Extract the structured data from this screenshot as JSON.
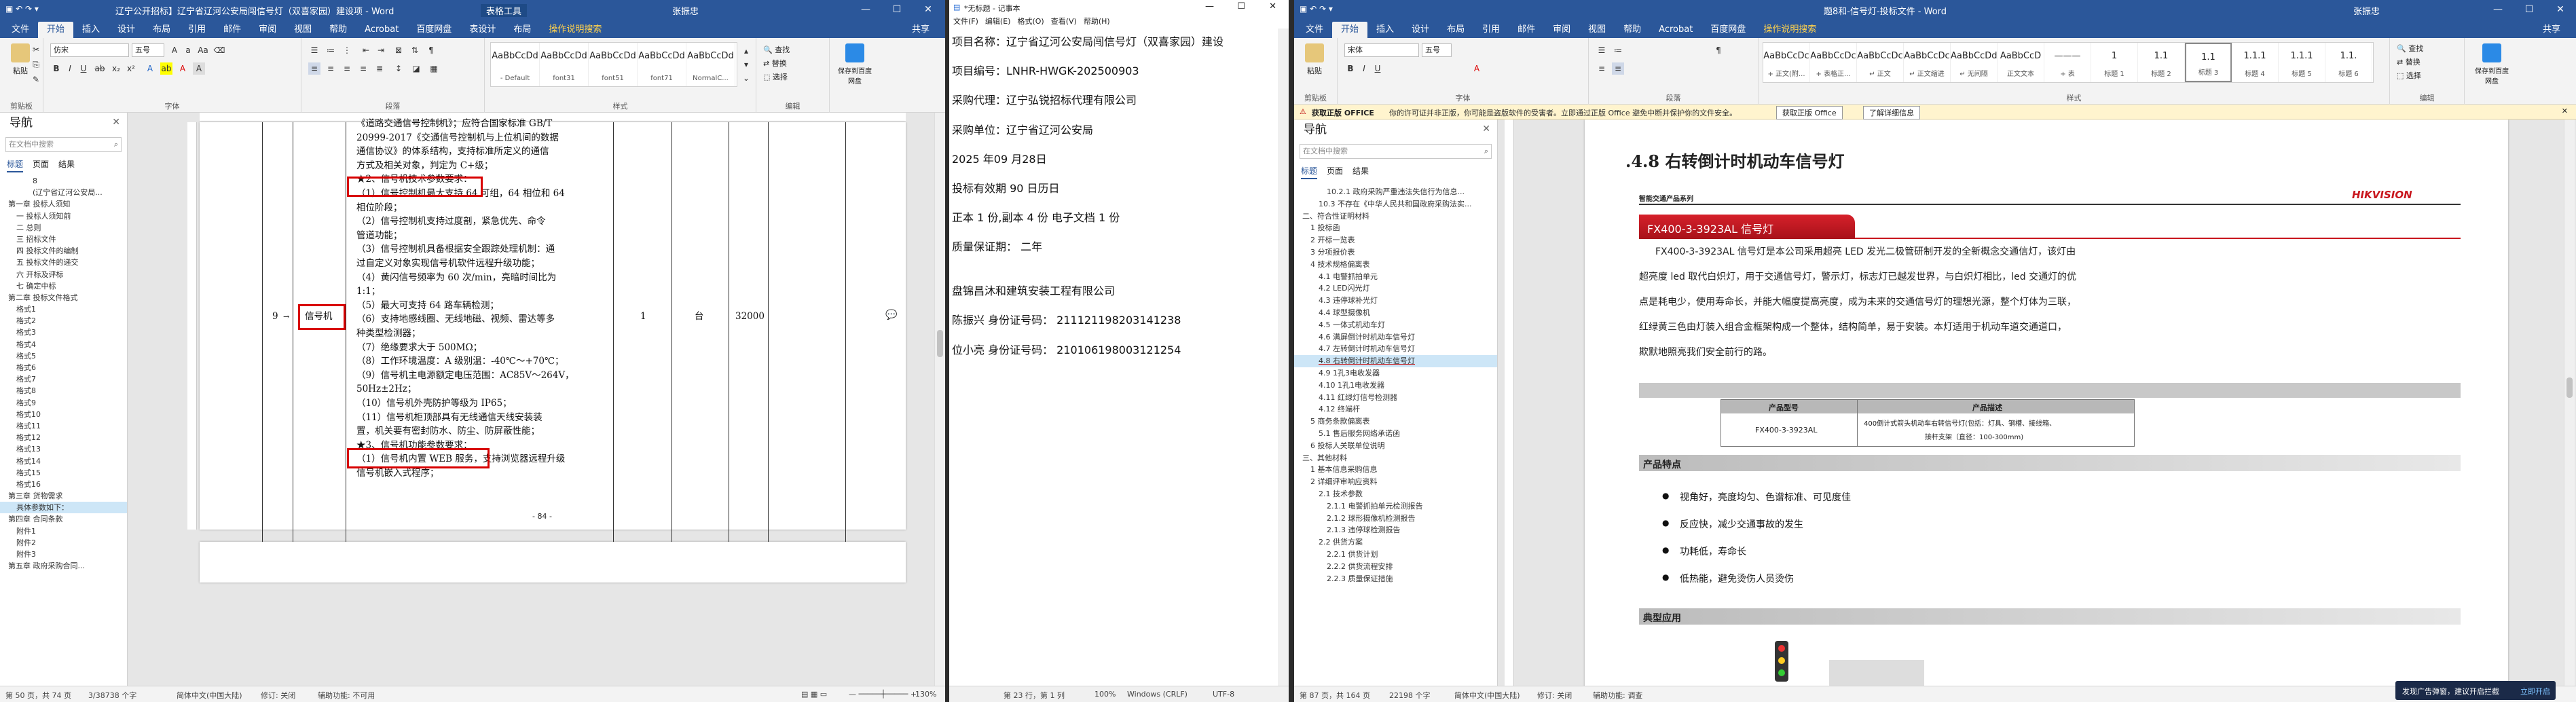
{
  "window1": {
    "title": "辽宁公开招标】辽宁省辽河公安局闯信号灯（双喜家园）建设项 - Word",
    "context_tab": "表格工具",
    "user": "张振忠",
    "share": "共享",
    "tabs": [
      "文件",
      "开始",
      "插入",
      "设计",
      "布局",
      "引用",
      "邮件",
      "审阅",
      "视图",
      "帮助",
      "Acrobat",
      "百度网盘",
      "表设计",
      "布局",
      "操作说明搜索"
    ],
    "font_name": "仿宋",
    "font_size": "五号",
    "clipboard_label": "剪贴板",
    "paste_label": "粘贴",
    "font_label": "字体",
    "para_label": "段落",
    "styles_label": "样式",
    "edit_label": "编辑",
    "save_label": "保存到百度网盘",
    "styles": [
      {
        "preview": "AaBbCcDd",
        "name": "- Default"
      },
      {
        "preview": "AaBbCcDd",
        "name": "font31"
      },
      {
        "preview": "AaBbCcDd",
        "name": "font51"
      },
      {
        "preview": "AaBbCcDd",
        "name": "font71"
      },
      {
        "preview": "AaBbCcDd",
        "name": "NormalC..."
      }
    ],
    "edit": [
      "查找",
      "替换",
      "选择"
    ],
    "nav": {
      "title": "导航",
      "search": "在文档中搜索",
      "tabs": [
        "标题",
        "页面",
        "结果"
      ],
      "items": [
        "8",
        "(辽宁省辽河公安局...",
        "第一章 投标人须知",
        "一 投标人须知前",
        "二 总则",
        "三 招标文件",
        "四 投标文件的编制",
        "五 投标文件的递交",
        "六 开标及评标",
        "七 确定中标",
        "第二章 投标文件格式",
        "格式1",
        "格式2",
        "格式3",
        "格式4",
        "格式5",
        "格式6",
        "格式7",
        "格式8",
        "格式9",
        "格式10",
        "格式11",
        "格式12",
        "格式13",
        "格式14",
        "格式15",
        "格式16",
        "第三章 货物需求",
        "具体参数如下：",
        "第四章 合同条款",
        "附件1",
        "附件2",
        "附件3",
        "第五章 政府采购合同..."
      ]
    },
    "doc": {
      "row_no": "9",
      "item": "信号机",
      "qty": "1",
      "unit": "台",
      "price": "32000",
      "lines": [
        "《道路交通信号控制机》；应符合国家标准 GB/T",
        "20999-2017《交通信号控制机与上位机间的数据",
        "通信协议》的体系结构，支持标准所定义的通信",
        "方式及相关对象，判定为 C+级；",
        "★2、信号机技术参数要求：",
        "（1）信号控制机最大支持 64 可组，64 相位和 64",
        "相位阶段；",
        "（2）信号控制机支持过度剖，紧急优先、命令",
        "管道功能；",
        "（3）信号控制机具备根据安全跟踪处理机制：通",
        "过自定义对象实现信号机软件远程升级功能；",
        "（4）黄闪信号频率为 60 次/min，亮暗时间比为",
        "1:1；",
        "（5）最大可支持 64 路车辆检测；",
        "（6）支持地感线圈、无线地磁、视频、雷达等多",
        "种类型检测器；",
        "（7）绝缘要求大于 500MΩ；",
        "（8）工作环境温度：A 级别温：-40℃～+70℃；",
        "（9）信号机主电源额定电压范围：AC85V～264V，",
        "50Hz±2Hz；",
        "（10）信号机外壳防护等级为 IP65；",
        "（11）信号机柜顶部具有无线通信天线安装装",
        "置，机关要有密封防水、防尘、防屏蔽性能；",
        "★3、信号机功能参数要求：",
        "（1）信号机内置 WEB 服务，支持浏览器远程升级",
        "信号机嵌入式程序；"
      ],
      "page_num": "- 84 -"
    },
    "status": {
      "page": "第 50 页，共 74 页",
      "words": "3/38738 个字",
      "lang": "简体中文(中国大陆)",
      "track": "修订: 关闭",
      "access": "辅助功能: 不可用",
      "zoom": "130%"
    }
  },
  "window2": {
    "title": "*无标题 - 记事本",
    "menu": [
      "文件(F)",
      "编辑(E)",
      "格式(O)",
      "查看(V)",
      "帮助(H)"
    ],
    "lines": [
      "项目名称：辽宁省辽河公安局闯信号灯（双喜家园）建设",
      "",
      "项目编号：LNHR-HWGK-202500903",
      "",
      "采购代理：辽宁弘锐招标代理有限公司",
      "",
      "采购单位：辽宁省辽河公安局",
      "",
      "2025 年09 月28日",
      "",
      "投标有效期 90  日历日",
      "",
      "正本 1 份,副本 4 份  电子文档  1  份",
      "",
      "质量保证期：  二年",
      "",
      "",
      "盘锦昌沐和建筑安装工程有限公司",
      "",
      "陈振兴  身份证号码：  211121198203141238",
      "",
      "位小亮  身份证号码：  210106198003121254"
    ],
    "status": {
      "pos": "第 23 行，第 1 列",
      "zoom": "100%",
      "eol": "Windows (CRLF)",
      "enc": "UTF-8"
    }
  },
  "window3": {
    "title": "题8和-信号灯-投标文件 - Word",
    "user": "张振忠",
    "share": "共享",
    "tabs": [
      "文件",
      "开始",
      "插入",
      "设计",
      "布局",
      "引用",
      "邮件",
      "审阅",
      "视图",
      "帮助",
      "Acrobat",
      "百度网盘",
      "操作说明搜索"
    ],
    "font_name": "宋体",
    "font_size": "五号",
    "styles": [
      {
        "preview": "AaBbCcDc",
        "name": "+ 正文(附..."
      },
      {
        "preview": "AaBbCcDc",
        "name": "+ 表格正..."
      },
      {
        "preview": "AaBbCcDc",
        "name": "↵ 正文"
      },
      {
        "preview": "AaBbCcDc",
        "name": "↵ 正文缩进"
      },
      {
        "preview": "AaBbCcDd",
        "name": "↵ 无间隔"
      },
      {
        "preview": "AaBbCcD",
        "name": "正文文本"
      },
      {
        "preview": "———",
        "name": "+ 表"
      },
      {
        "preview": "1",
        "name": "标题 1"
      },
      {
        "preview": "1.1",
        "name": "标题 2"
      },
      {
        "preview": "1.1",
        "name": "标题 3"
      },
      {
        "preview": "1.1.1",
        "name": "标题 4"
      },
      {
        "preview": "1.1.1",
        "name": "标题 5"
      },
      {
        "preview": "1.1.",
        "name": "标题 6"
      }
    ],
    "edit": [
      "查找",
      "替换",
      "选择"
    ],
    "save_label": "保存到百度网盘",
    "infobar": {
      "badge": "获取正版 OFFICE",
      "text": "你的许可证并非正版，你可能是盗版软件的受害者。立即通过正版 Office 避免中断并保护你的文件安全。",
      "btn1": "获取正版 Office",
      "btn2": "了解详细信息"
    },
    "nav": {
      "title": "导航",
      "search": "在文档中搜索",
      "tabs": [
        "标题",
        "页面",
        "结果"
      ],
      "items": [
        "10.2.1 政府采购严重违法失信行为信息...",
        "10.3 不存在《中华人民共和国政府采购法实...",
        "二、符合性证明材料",
        "1 投标函",
        "2 开标一览表",
        "3 分项报价表",
        "4 技术规格偏离表",
        "4.1 电警抓拍单元",
        "4.2 LED闪光灯",
        "4.3 违停球补光灯",
        "4.4 球型摄像机",
        "4.5 一体式机动车灯",
        "4.6 满屏倒计时机动车信号灯",
        "4.7 左转倒计时机动车信号灯",
        "4.8 右转倒计时机动车信号灯",
        "4.9 1孔3电收发器",
        "4.10 1孔1电收发器",
        "4.11 红绿灯信号检测器",
        "4.12 终端杆",
        "5 商务条款偏离表",
        "5.1 售后服务网络承诺函",
        "6 投标人关联单位说明",
        "三、其他材料",
        "1 基本信息采购信息",
        "2 详细评审响应资料",
        "2.1 技术参数",
        "2.1.1 电警抓拍单元检测报告",
        "2.1.2 球形摄像机检测报告",
        "2.1.3 违停球检测报告",
        "2.2 供货方案",
        "2.2.1 供货计划",
        "2.2.2 供货流程安排",
        "2.2.3 质量保证措施"
      ]
    },
    "doc": {
      "heading": ".4.8   右转倒计时机动车信号灯",
      "series": "智能交通产品系列",
      "brand": "HIKVISION",
      "product": "FX400-3-3923AL 信号灯",
      "desc": [
        "FX400-3-3923AL 信号灯是本公司采用超亮 LED 发光二极管研制开发的全新概念交通信灯，该灯由",
        "超亮度 led 取代白炽灯，用于交通信号灯，警示灯，标志灯已越发世界，与白炽灯相比，led 交通灯的优",
        "点是耗电少，使用寿命长，并能大幅度提高亮度，成为未来的交通信号灯的理想光源，整个灯体为三联，",
        "红绿黄三色由灯装入组合金框架构成一个整体，结构简单，易于安装。本灯适用于机动车道交通道口，",
        "欺默地照亮我们安全前行的路。"
      ],
      "table": {
        "h1": "产品型号",
        "h2": "产品描述",
        "model": "FX400-3-3923AL",
        "d1": "400倒计式箭头机动车右转信号灯(包括：灯具、钢槽、接线箱、",
        "d2": "接杆支架（直径：100-300mm)"
      },
      "feature_title": "产品特点",
      "features": [
        "视角好，亮度均匀、色谱标准、可见度佳",
        "反应快，减少交通事故的发生",
        "功耗低，寿命长",
        "低热能，避免烫伤人员烫伤"
      ],
      "app_title": "典型应用"
    },
    "status": {
      "page": "第 87 页，共 164 页",
      "words": "22198 个字",
      "lang": "简体中文(中国大陆)",
      "track": "修订: 关闭",
      "access": "辅助功能: 调查",
      "tray": "发现广告弹窗，建议开启拦截",
      "tray_btn": "立即开启"
    }
  },
  "colors": {
    "word_blue": "#2b579a",
    "red_box": "#d80000",
    "hik_red": "#c8161d",
    "infobar": "#fff4ce"
  }
}
